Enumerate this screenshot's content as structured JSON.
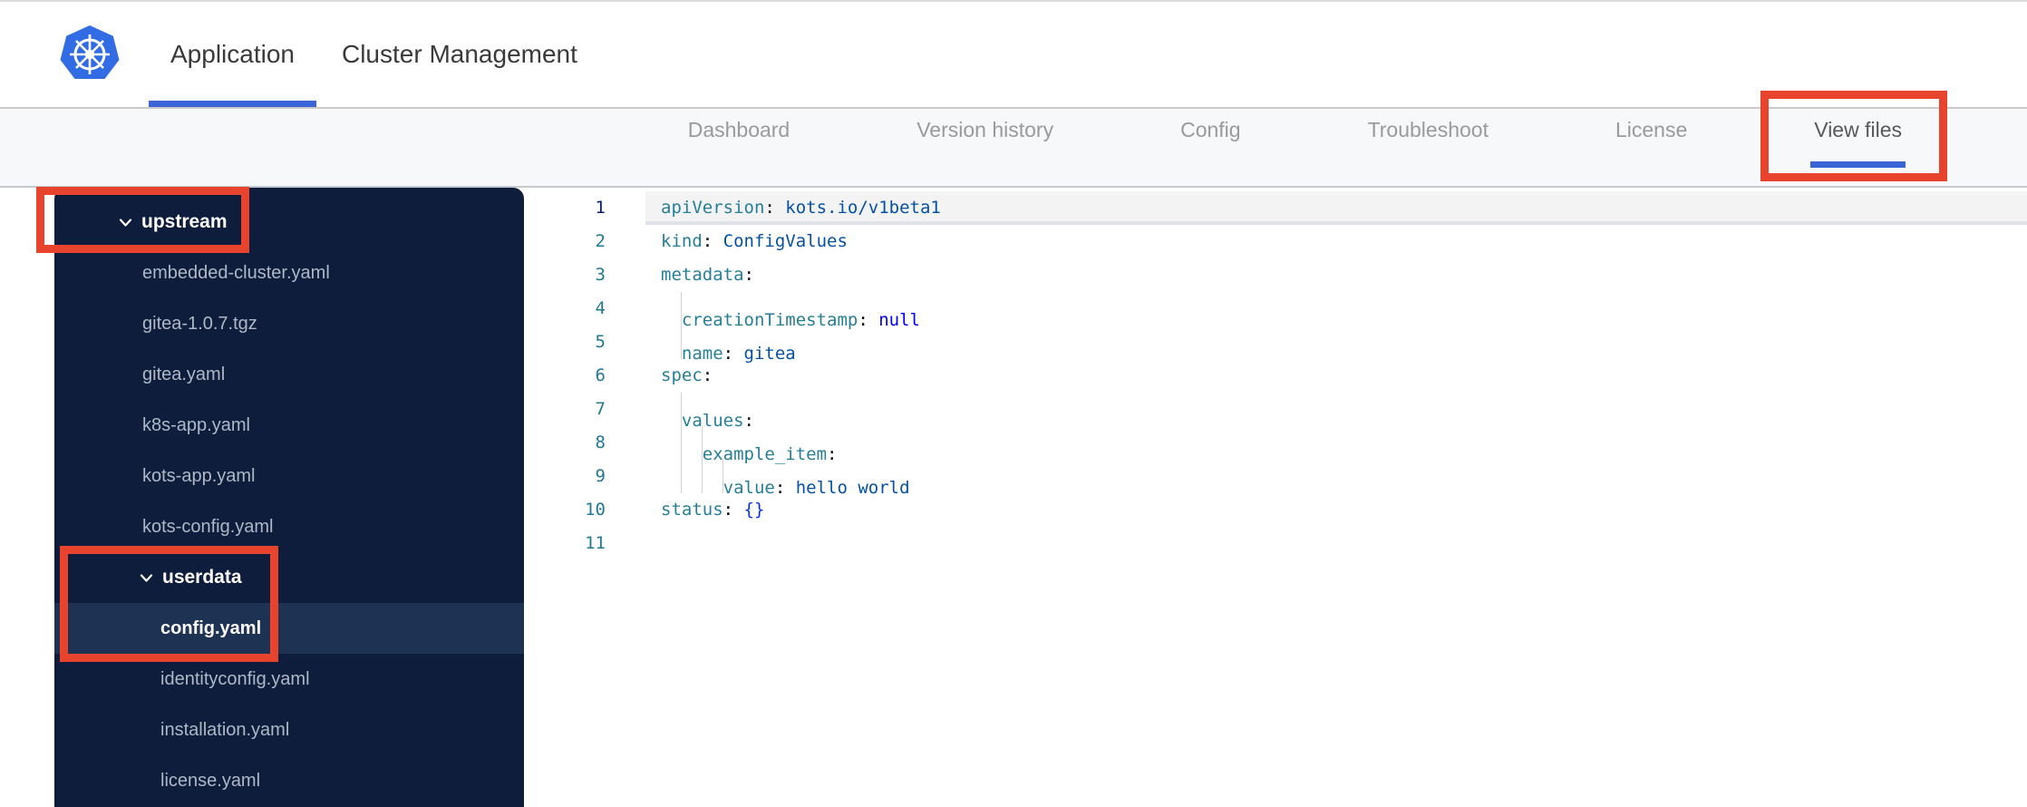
{
  "header": {
    "tabs": [
      {
        "label": "Application",
        "active": true
      },
      {
        "label": "Cluster Management",
        "active": false
      }
    ]
  },
  "nav": {
    "tabs": [
      {
        "label": "Dashboard",
        "active": false
      },
      {
        "label": "Version history",
        "active": false
      },
      {
        "label": "Config",
        "active": false
      },
      {
        "label": "Troubleshoot",
        "active": false
      },
      {
        "label": "License",
        "active": false
      },
      {
        "label": "View files",
        "active": true
      }
    ],
    "active_tab": "View files"
  },
  "sidebar": {
    "items": [
      {
        "label": "upstream",
        "kind": "folder",
        "level": 1,
        "expanded": true,
        "selected": false
      },
      {
        "label": "embedded-cluster.yaml",
        "kind": "file",
        "level": 1,
        "selected": false
      },
      {
        "label": "gitea-1.0.7.tgz",
        "kind": "file",
        "level": 1,
        "selected": false
      },
      {
        "label": "gitea.yaml",
        "kind": "file",
        "level": 1,
        "selected": false
      },
      {
        "label": "k8s-app.yaml",
        "kind": "file",
        "level": 1,
        "selected": false
      },
      {
        "label": "kots-app.yaml",
        "kind": "file",
        "level": 1,
        "selected": false
      },
      {
        "label": "kots-config.yaml",
        "kind": "file",
        "level": 1,
        "selected": false
      },
      {
        "label": "userdata",
        "kind": "folder",
        "level": 2,
        "expanded": true,
        "selected": false
      },
      {
        "label": "config.yaml",
        "kind": "file",
        "level": 2,
        "selected": true
      },
      {
        "label": "identityconfig.yaml",
        "kind": "file",
        "level": 2,
        "selected": false
      },
      {
        "label": "installation.yaml",
        "kind": "file",
        "level": 2,
        "selected": false
      },
      {
        "label": "license.yaml",
        "kind": "file",
        "level": 2,
        "selected": false
      }
    ]
  },
  "editor": {
    "lines": [
      {
        "num": 1,
        "current": true,
        "indent": 0,
        "tokens": [
          {
            "t": "key",
            "s": "apiVersion"
          },
          {
            "t": "plain",
            "s": ": "
          },
          {
            "t": "value",
            "s": "kots.io/v1beta1"
          }
        ]
      },
      {
        "num": 2,
        "current": false,
        "indent": 0,
        "tokens": [
          {
            "t": "key",
            "s": "kind"
          },
          {
            "t": "plain",
            "s": ": "
          },
          {
            "t": "value",
            "s": "ConfigValues"
          }
        ]
      },
      {
        "num": 3,
        "current": false,
        "indent": 0,
        "tokens": [
          {
            "t": "key",
            "s": "metadata"
          },
          {
            "t": "plain",
            "s": ":"
          }
        ]
      },
      {
        "num": 4,
        "current": false,
        "indent": 2,
        "tokens": [
          {
            "t": "key",
            "s": "creationTimestamp"
          },
          {
            "t": "plain",
            "s": ": "
          },
          {
            "t": "keyword",
            "s": "null"
          }
        ]
      },
      {
        "num": 5,
        "current": false,
        "indent": 2,
        "tokens": [
          {
            "t": "key",
            "s": "name"
          },
          {
            "t": "plain",
            "s": ": "
          },
          {
            "t": "value",
            "s": "gitea"
          }
        ]
      },
      {
        "num": 6,
        "current": false,
        "indent": 0,
        "tokens": [
          {
            "t": "key",
            "s": "spec"
          },
          {
            "t": "plain",
            "s": ":"
          }
        ]
      },
      {
        "num": 7,
        "current": false,
        "indent": 2,
        "tokens": [
          {
            "t": "key",
            "s": "values"
          },
          {
            "t": "plain",
            "s": ":"
          }
        ]
      },
      {
        "num": 8,
        "current": false,
        "indent": 4,
        "tokens": [
          {
            "t": "key",
            "s": "example_item"
          },
          {
            "t": "plain",
            "s": ":"
          }
        ]
      },
      {
        "num": 9,
        "current": false,
        "indent": 6,
        "tokens": [
          {
            "t": "key",
            "s": "value"
          },
          {
            "t": "plain",
            "s": ": "
          },
          {
            "t": "value",
            "s": "hello world"
          }
        ]
      },
      {
        "num": 10,
        "current": false,
        "indent": 0,
        "tokens": [
          {
            "t": "key",
            "s": "status"
          },
          {
            "t": "plain",
            "s": ": "
          },
          {
            "t": "bracket",
            "s": "{}"
          }
        ]
      },
      {
        "num": 11,
        "current": false,
        "indent": 0,
        "tokens": []
      }
    ]
  },
  "annotations": {
    "targets": [
      "view-files-tab",
      "upstream-folder",
      "userdata-config-yaml"
    ]
  },
  "colors": {
    "annotation_red": "#e8432c",
    "accent_blue": "#3b64d7",
    "kubernetes_blue": "#326ce5",
    "sidebar_bg": "#0f1d3c",
    "sidebar_selected_bg": "#1e3354",
    "sidebar_file_text": "#aeb8c6",
    "nav_bg": "#f7f8fa",
    "nav_text": "#9a9a9a",
    "nav_active_text": "#57585a",
    "editor_key": "#267f99",
    "editor_value": "#0451a5",
    "editor_keyword": "#0000ff",
    "editor_bracket": "#0431fa",
    "editor_linenumber": "#237893",
    "editor_active_linenumber": "#0b216f"
  }
}
